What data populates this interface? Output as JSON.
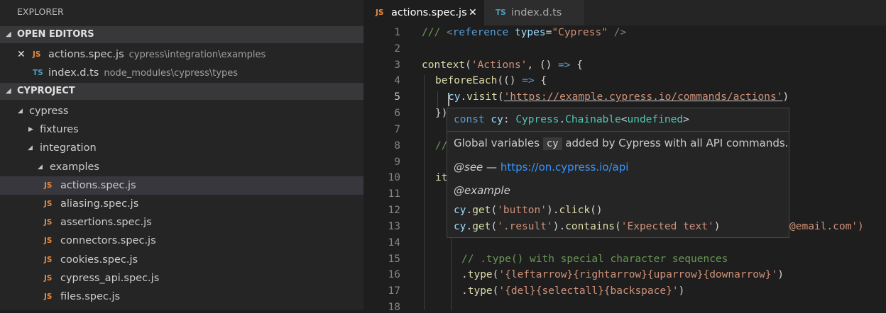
{
  "explorer": {
    "title": "EXPLORER",
    "open_editors": {
      "label": "OPEN EDITORS",
      "items": [
        {
          "icon": "JS",
          "name": "actions.spec.js",
          "path": "cypress\\integration\\examples"
        },
        {
          "icon": "TS",
          "name": "index.d.ts",
          "path": "node_modules\\cypress\\types"
        }
      ]
    },
    "project": {
      "label": "CYPROJECT",
      "tree": [
        {
          "name": "cypress"
        },
        {
          "name": "fixtures"
        },
        {
          "name": "integration"
        },
        {
          "name": "examples"
        },
        {
          "icon": "JS",
          "name": "actions.spec.js"
        },
        {
          "icon": "JS",
          "name": "aliasing.spec.js"
        },
        {
          "icon": "JS",
          "name": "assertions.spec.js"
        },
        {
          "icon": "JS",
          "name": "connectors.spec.js"
        },
        {
          "icon": "JS",
          "name": "cookies.spec.js"
        },
        {
          "icon": "JS",
          "name": "cypress_api.spec.js"
        },
        {
          "icon": "JS",
          "name": "files.spec.js"
        }
      ]
    }
  },
  "tabs": [
    {
      "icon": "JS",
      "label": "actions.spec.js",
      "close": "✕"
    },
    {
      "icon": "TS",
      "label": "index.d.ts"
    }
  ],
  "editor": {
    "line_numbers": [
      "1",
      "2",
      "3",
      "4",
      "5",
      "6",
      "7",
      "8",
      "9",
      "10",
      "11",
      "12",
      "13",
      "14",
      "15",
      "16",
      "17",
      "18"
    ],
    "line1": {
      "a": "/// ",
      "b": "<",
      "c": "reference",
      "d": " types",
      "e": "=",
      "f": "\"Cypress\"",
      "g": " />"
    },
    "line3": {
      "a": "context",
      "b": "(",
      "c": "'Actions'",
      "d": ", () ",
      "e": "=>",
      "f": " {"
    },
    "line4": {
      "a": "beforeEach",
      "b": "(() ",
      "c": "=>",
      "d": " {"
    },
    "line5": {
      "a": "cy",
      "b": ".",
      "c": "visit",
      "d": "(",
      "e": "'https://example.cypress.io/commands/actions'",
      "f": ")"
    },
    "line6": {
      "a": "})"
    },
    "line8": {
      "a": "//"
    },
    "line10": {
      "a": "it"
    },
    "line13_tail": "@email.com')",
    "line15": {
      "a": "// .type() with special character sequences"
    },
    "line16": {
      "a": ".",
      "b": "type",
      "c": "(",
      "d": "'{leftarrow}{rightarrow}{uparrow}{downarrow}'",
      "e": ")"
    },
    "line17": {
      "a": ".",
      "b": "type",
      "c": "(",
      "d": "'{del}{selectall}{backspace}'",
      "e": ")"
    }
  },
  "hover": {
    "sig": {
      "a": "const",
      "b": " cy",
      "c": ": ",
      "d": "Cypress",
      "e": ".",
      "f": "Chainable",
      "g": "<",
      "h": "undefined",
      "i": ">"
    },
    "desc_a": "Global variables ",
    "desc_code": "cy",
    "desc_b": " added by Cypress with all API commands.",
    "see_tag": "@see",
    "see_dash": " — ",
    "see_link": "https://on.cypress.io/api",
    "example_tag": "@example",
    "ex1": {
      "a": "cy",
      "b": ".",
      "c": "get",
      "d": "(",
      "e": "'button'",
      "f": ").",
      "g": "click",
      "h": "()"
    },
    "ex2": {
      "a": "cy",
      "b": ".",
      "c": "get",
      "d": "(",
      "e": "'.result'",
      "f": ").",
      "g": "contains",
      "h": "(",
      "i": "'Expected text'",
      "j": ")"
    }
  }
}
